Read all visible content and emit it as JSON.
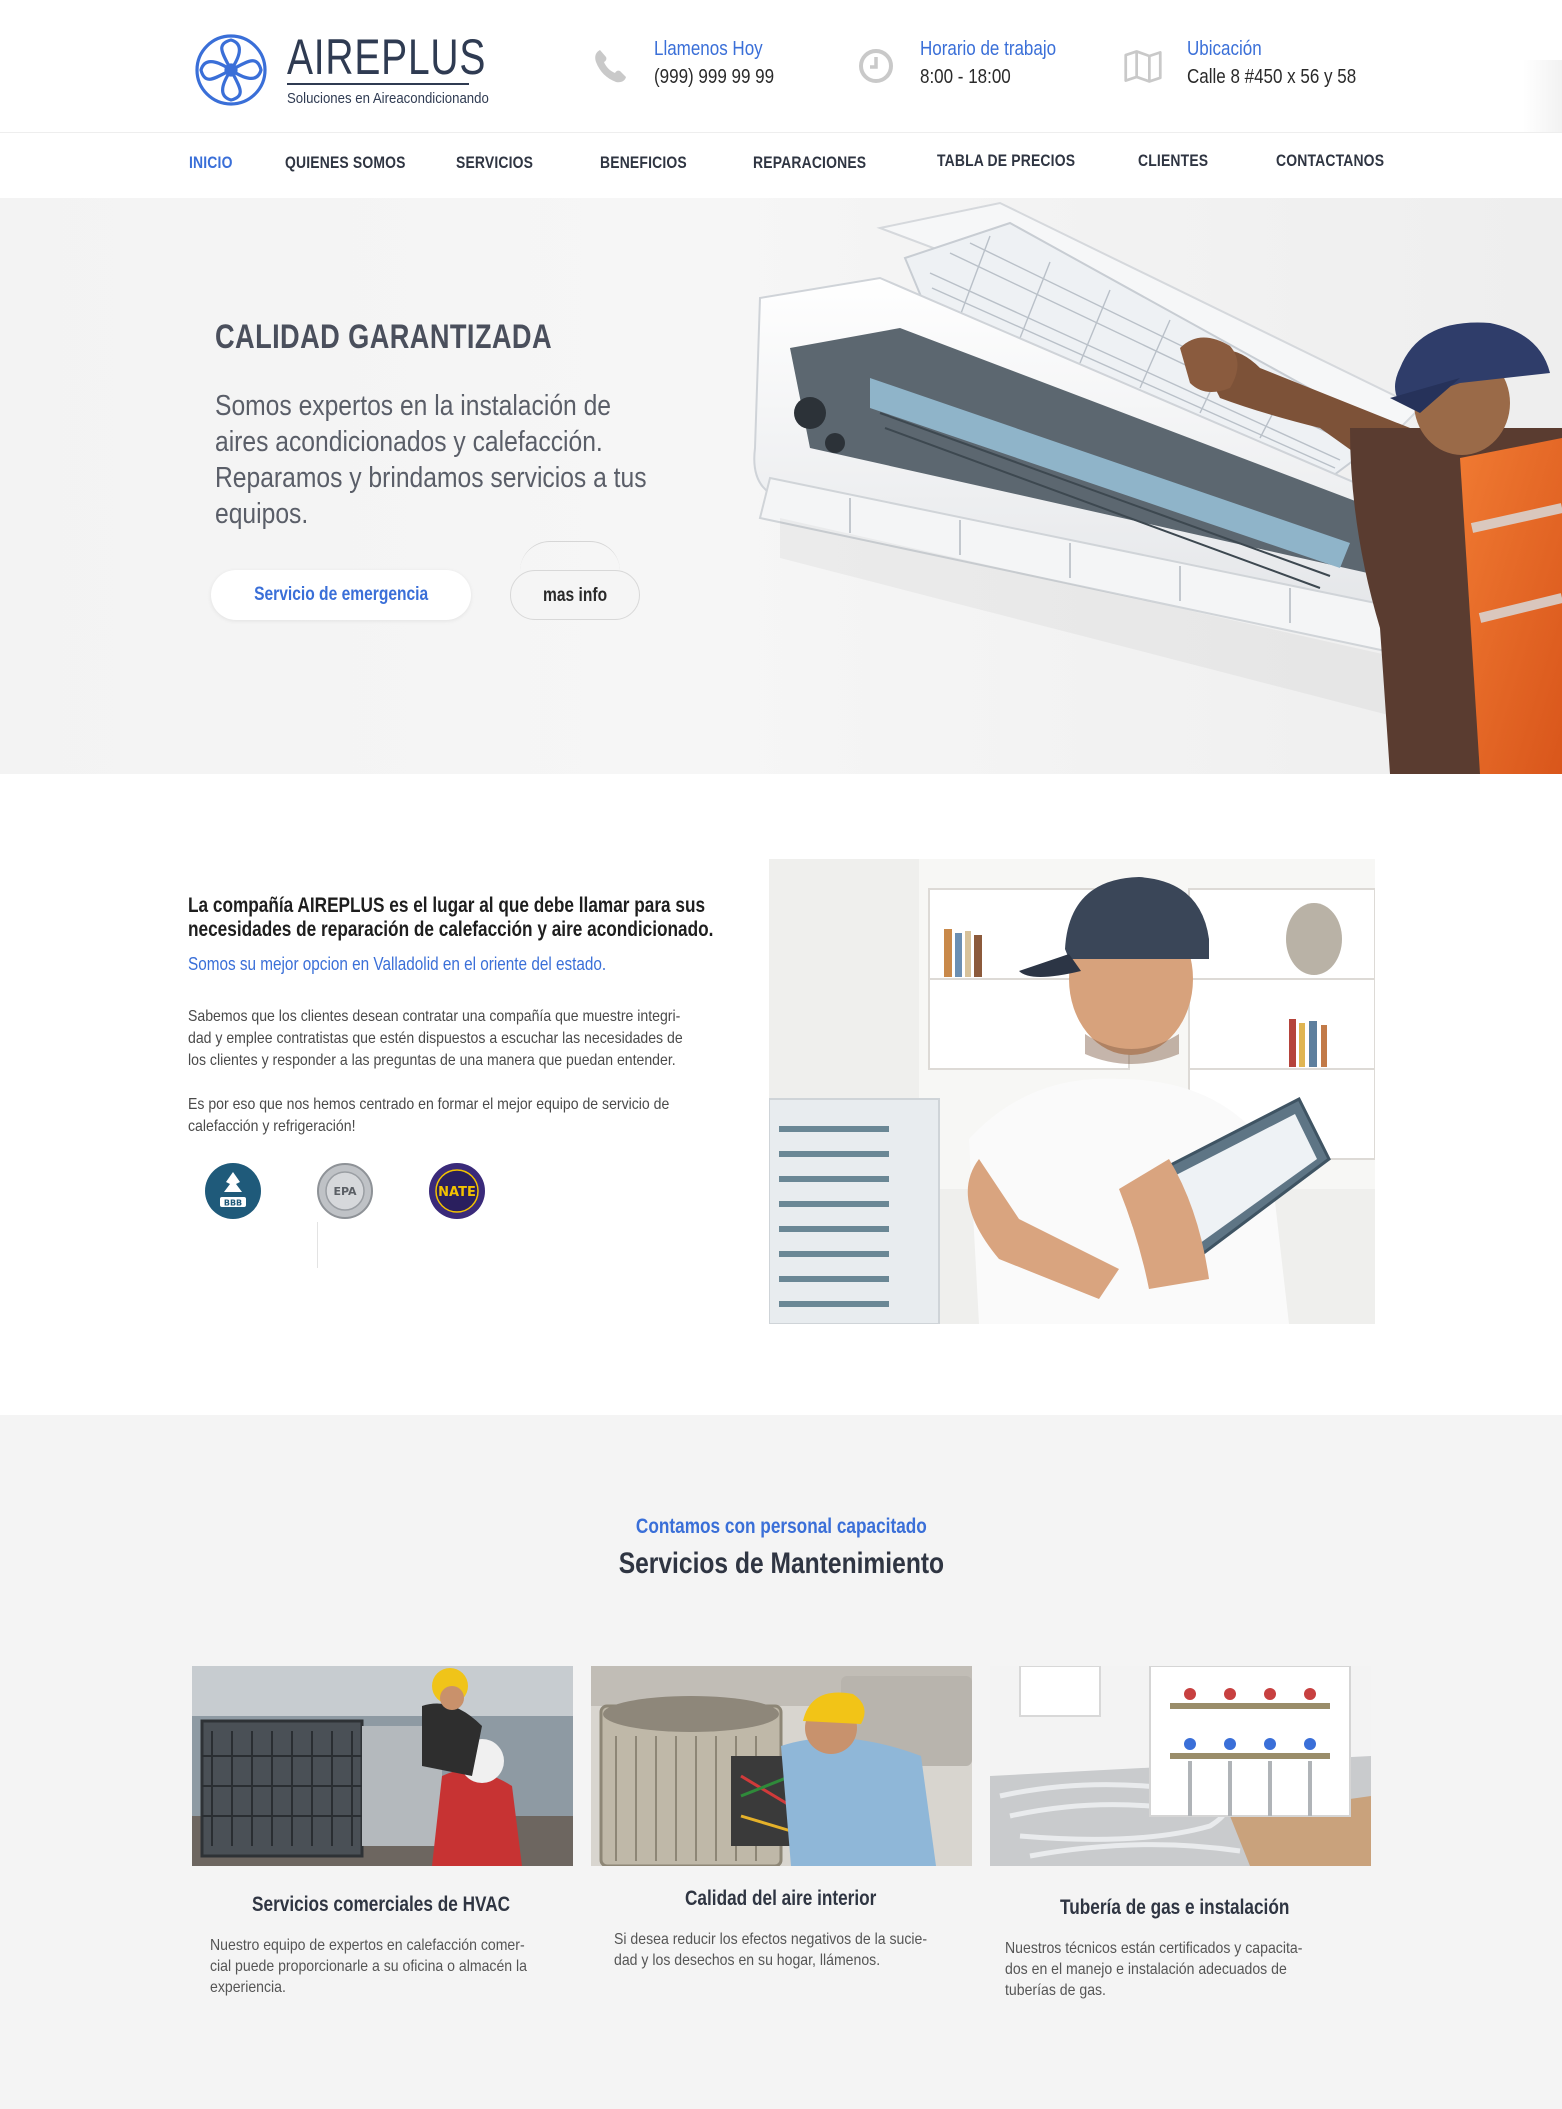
{
  "brand": {
    "name": "AIREPLUS",
    "tagline": "Soluciones en Aireacondicionando",
    "primary_color": "#3a6fd8",
    "dark_color": "#2f3542"
  },
  "contact": {
    "phone": {
      "icon": "phone-icon",
      "label": "Llamenos Hoy",
      "value": "(999) 999 99 99"
    },
    "hours": {
      "icon": "clock-icon",
      "label": "Horario de trabajo",
      "value": "8:00  -  18:00"
    },
    "location": {
      "icon": "map-icon",
      "label": "Ubicación",
      "value": "Calle 8 #450 x 56 y 58"
    }
  },
  "nav": {
    "items": [
      {
        "label": "INICIO",
        "active": true
      },
      {
        "label": "QUIENES SOMOS",
        "active": false
      },
      {
        "label": "SERVICIOS",
        "active": false
      },
      {
        "label": "BENEFICIOS",
        "active": false
      },
      {
        "label": "REPARACIONES",
        "active": false
      },
      {
        "label": "TABLA DE PRECIOS",
        "active": false
      },
      {
        "label": "CLIENTES",
        "active": false
      },
      {
        "label": "CONTACTANOS",
        "active": false
      }
    ]
  },
  "hero": {
    "title": "CALIDAD GARANTIZADA",
    "text": "Somos expertos en la instalación de aires acondicionados y calefacción. Reparamos y brindamos servicios a tus equipos.",
    "primary_button": "Servicio de emergencia",
    "secondary_button": "mas info"
  },
  "about": {
    "heading_line1": "La compañía AIREPLUS es el lugar al que debe llamar para sus",
    "heading_line2": "necesidades de reparación de calefacción y aire acondicionado.",
    "subheading": "Somos su mejor opcion en Valladolid en el oriente del estado.",
    "paragraph1": [
      "Sabemos que los clientes desean contratar una compañía  que muestre integri-",
      "dad y emplee contratistas que estén dispuestos a escuchar las necesidades de",
      "los clientes y responder a las preguntas de una manera que puedan entender."
    ],
    "paragraph2": [
      "Es por eso que nos hemos centrado en formar el mejor equipo de servicio de",
      "calefacción y refrigeración!"
    ],
    "badges": [
      {
        "icon": "bbb-badge-icon",
        "text": "BBB"
      },
      {
        "icon": "epa-badge-icon",
        "text": "EPA"
      },
      {
        "icon": "nate-badge-icon",
        "text": "NATE"
      }
    ]
  },
  "services": {
    "kicker": "Contamos con personal capacitado",
    "title": "Servicios de Mantenimiento",
    "cards": [
      {
        "title": "Servicios comerciales de HVAC",
        "lines": [
          "Nuestro equipo de expertos en calefacción comer-",
          "cial puede proporcionarle a su oficina o almacén la",
          "experiencia."
        ]
      },
      {
        "title": "Calidad del aire interior",
        "lines": [
          "Si desea reducir los efectos negativos de la sucie-",
          "dad y los desechos en su hogar, llámenos."
        ]
      },
      {
        "title": "Tubería de gas e instalación",
        "lines": [
          "Nuestros técnicos están certificados y capacita-",
          "dos en el manejo e instalación adecuados de",
          "tuberías de gas."
        ]
      }
    ]
  }
}
